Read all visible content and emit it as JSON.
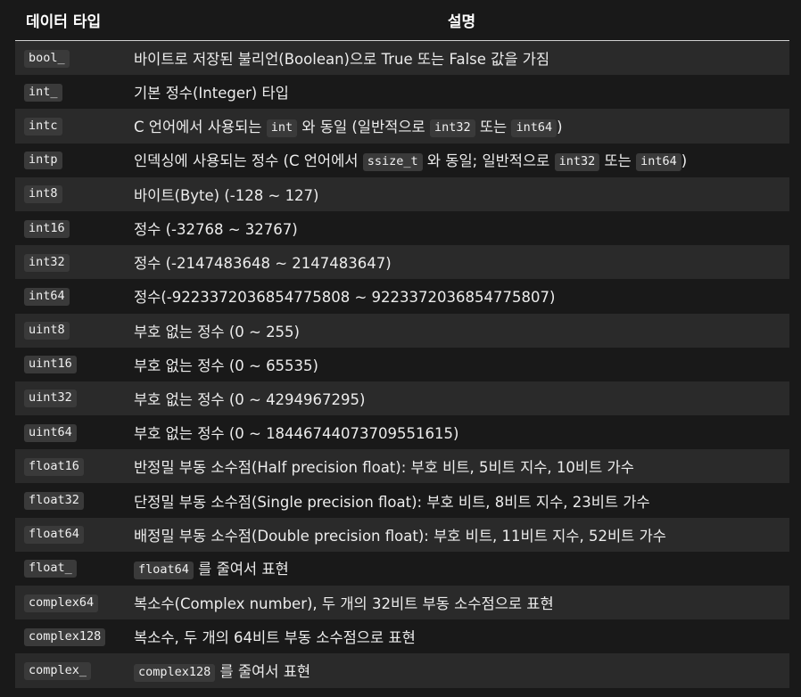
{
  "header": {
    "type_col": "데이터 타입",
    "desc_col": "설명"
  },
  "rows": [
    {
      "type": "bool_",
      "desc": [
        {
          "t": "바이트로 저장된 불리언(Boolean)으로 True 또는 False 값을 가짐"
        }
      ]
    },
    {
      "type": "int_",
      "desc": [
        {
          "t": "기본 정수(Integer) 타입"
        }
      ]
    },
    {
      "type": "intc",
      "desc": [
        {
          "t": "C 언어에서 사용되는 "
        },
        {
          "c": "int"
        },
        {
          "t": " 와 동일 (일반적으로 "
        },
        {
          "c": "int32"
        },
        {
          "t": " 또는 "
        },
        {
          "c": "int64"
        },
        {
          "t": ")"
        }
      ]
    },
    {
      "type": "intp",
      "desc": [
        {
          "t": "인덱싱에 사용되는 정수 (C 언어에서 "
        },
        {
          "c": "ssize_t"
        },
        {
          "t": " 와 동일; 일반적으로 "
        },
        {
          "c": "int32"
        },
        {
          "t": " 또는 "
        },
        {
          "c": "int64"
        },
        {
          "t": ")"
        }
      ]
    },
    {
      "type": "int8",
      "desc": [
        {
          "t": "바이트(Byte) (-128 ~ 127)"
        }
      ]
    },
    {
      "type": "int16",
      "desc": [
        {
          "t": "정수 (-32768 ~ 32767)"
        }
      ]
    },
    {
      "type": "int32",
      "desc": [
        {
          "t": "정수 (-2147483648 ~ 2147483647)"
        }
      ]
    },
    {
      "type": "int64",
      "desc": [
        {
          "t": "정수(-9223372036854775808 ~ 9223372036854775807)"
        }
      ]
    },
    {
      "type": "uint8",
      "desc": [
        {
          "t": "부호 없는 정수 (0 ~ 255)"
        }
      ]
    },
    {
      "type": "uint16",
      "desc": [
        {
          "t": "부호 없는 정수 (0 ~ 65535)"
        }
      ]
    },
    {
      "type": "uint32",
      "desc": [
        {
          "t": "부호 없는 정수 (0 ~ 4294967295)"
        }
      ]
    },
    {
      "type": "uint64",
      "desc": [
        {
          "t": "부호 없는 정수 (0 ~ 18446744073709551615)"
        }
      ]
    },
    {
      "type": "float16",
      "desc": [
        {
          "t": "반정밀 부동 소수점(Half precision float): 부호 비트, 5비트 지수, 10비트 가수"
        }
      ]
    },
    {
      "type": "float32",
      "desc": [
        {
          "t": "단정밀 부동 소수점(Single precision float): 부호 비트, 8비트 지수, 23비트 가수"
        }
      ]
    },
    {
      "type": "float64",
      "desc": [
        {
          "t": "배정밀 부동 소수점(Double precision float): 부호 비트, 11비트 지수, 52비트 가수"
        }
      ]
    },
    {
      "type": "float_",
      "desc": [
        {
          "c": "float64"
        },
        {
          "t": " 를 줄여서 표현"
        }
      ]
    },
    {
      "type": "complex64",
      "desc": [
        {
          "t": "복소수(Complex number), 두 개의 32비트 부동 소수점으로 표현"
        }
      ]
    },
    {
      "type": "complex128",
      "desc": [
        {
          "t": "복소수, 두 개의 64비트 부동 소수점으로 표현"
        }
      ]
    },
    {
      "type": "complex_",
      "desc": [
        {
          "c": "complex128"
        },
        {
          "t": " 를 줄여서 표현"
        }
      ]
    }
  ]
}
